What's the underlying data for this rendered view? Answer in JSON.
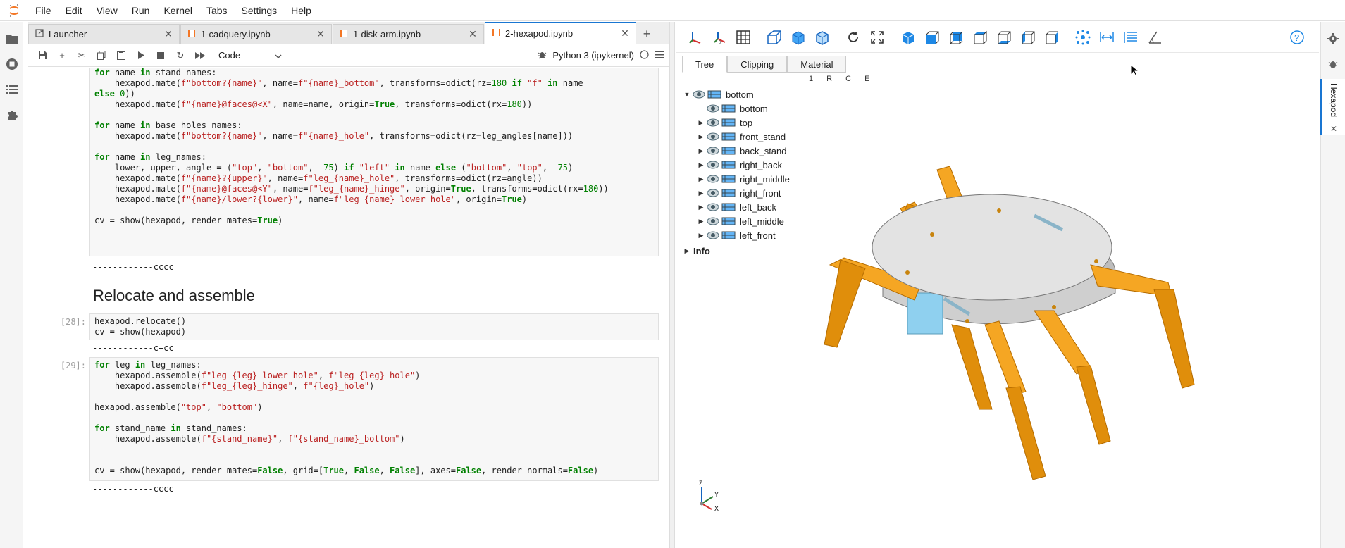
{
  "menubar": {
    "items": [
      "File",
      "Edit",
      "View",
      "Run",
      "Kernel",
      "Tabs",
      "Settings",
      "Help"
    ]
  },
  "tabs": [
    {
      "label": "Launcher",
      "icon": "launcher-icon",
      "active": false
    },
    {
      "label": "1-cadquery.ipynb",
      "icon": "notebook-icon",
      "active": false
    },
    {
      "label": "1-disk-arm.ipynb",
      "icon": "notebook-icon",
      "active": false
    },
    {
      "label": "2-hexapod.ipynb",
      "icon": "notebook-icon",
      "active": true
    }
  ],
  "toolbar": {
    "cell_type": "Code",
    "kernel": "Python 3 (ipykernel)"
  },
  "cells": {
    "c1_output": "------------cccc",
    "heading": "Relocate and assemble",
    "c2_prompt": "[28]:",
    "c2_output": "------------c+cc",
    "c3_prompt": "[29]:",
    "c3_output": "------------cccc"
  },
  "viewer": {
    "tabs": [
      "Tree",
      "Clipping",
      "Material"
    ],
    "letters": "1 R C E",
    "tree_root": "bottom",
    "tree_items": [
      "bottom",
      "top",
      "front_stand",
      "back_stand",
      "right_back",
      "right_middle",
      "right_front",
      "left_back",
      "left_middle",
      "left_front"
    ],
    "info_label": "Info",
    "axes": {
      "z": "Z",
      "y": "Y",
      "x": "X"
    },
    "colors": {
      "leg": "#f5a623",
      "body": "#e0e0e0",
      "panel": "#90d0f0",
      "accent": "#1976d2"
    }
  },
  "sidepanel": {
    "label": "Hexapod"
  }
}
